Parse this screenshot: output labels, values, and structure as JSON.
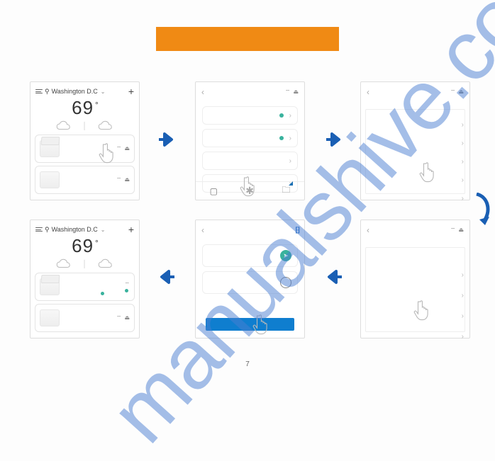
{
  "page_number": "7",
  "watermark": "manualshive.com",
  "home": {
    "location": "Washington D.C",
    "temperature": "69",
    "degree": "°"
  },
  "icons": {
    "wifi": "wifi",
    "lock": "lock",
    "chevron": "›",
    "back": "‹",
    "plus": "+",
    "pin": "⚲"
  }
}
